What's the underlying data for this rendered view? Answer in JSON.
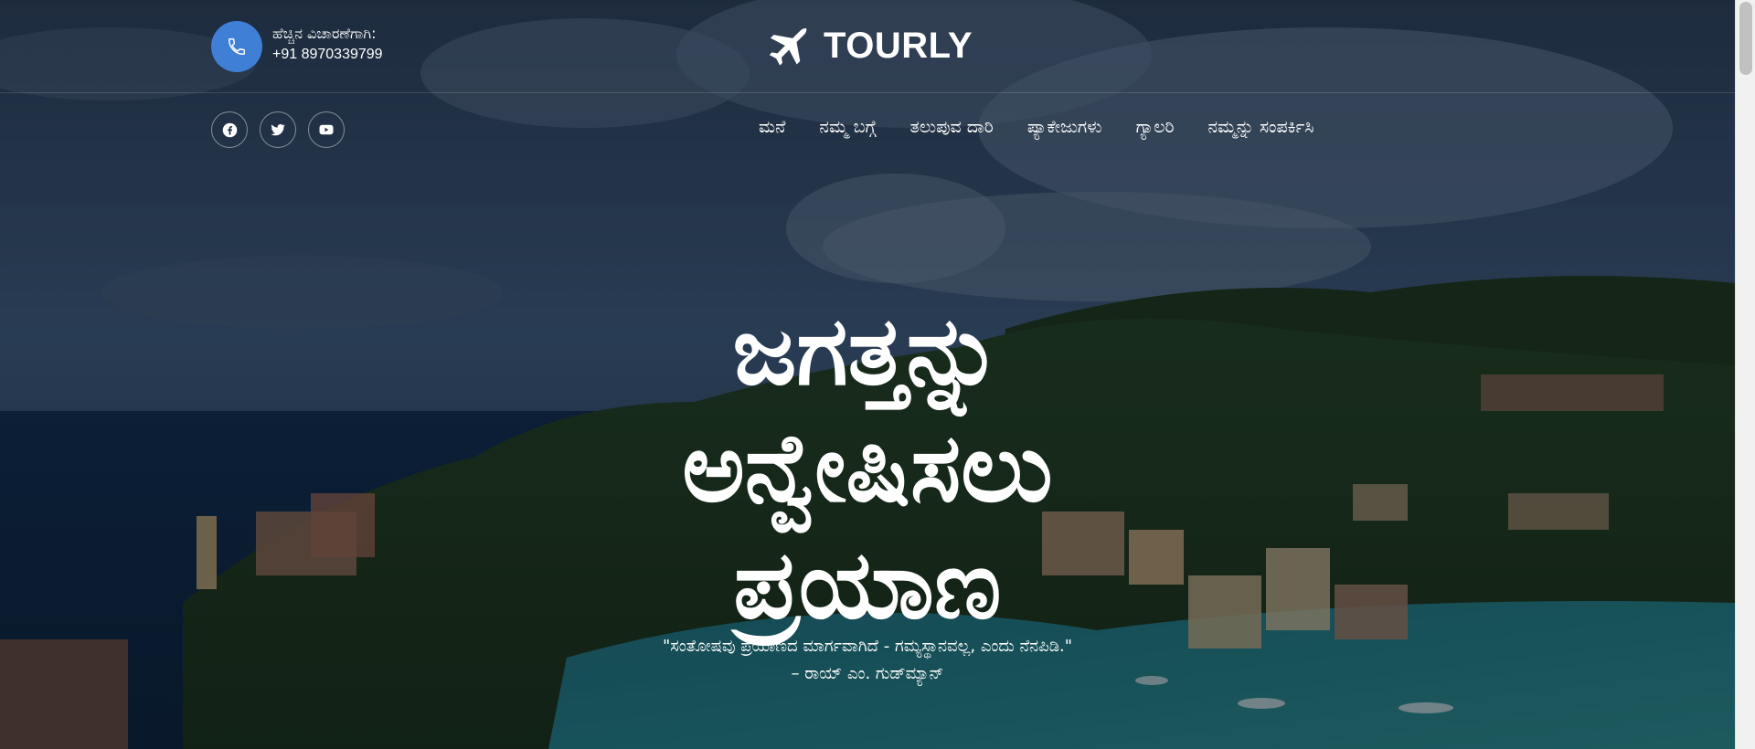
{
  "header": {
    "enquiry_label": "ಹೆಚ್ಚಿನ ವಿಚಾರಣೆಗಾಗಿ:",
    "phone": "+91 8970339799",
    "logo_text": "TOURLY"
  },
  "social": [
    {
      "icon": "facebook-icon"
    },
    {
      "icon": "twitter-icon"
    },
    {
      "icon": "youtube-icon"
    }
  ],
  "nav": {
    "items": [
      {
        "label": "ಮನೆ"
      },
      {
        "label": "ನಮ್ಮ ಬಗ್ಗೆ"
      },
      {
        "label": "ತಲುಪುವ ದಾರಿ"
      },
      {
        "label": "ಪ್ಯಾಕೇಜುಗಳು"
      },
      {
        "label": "ಗ್ಯಾಲರಿ"
      },
      {
        "label": "ನಮ್ಮನ್ನು ಸಂಪರ್ಕಿಸಿ"
      }
    ]
  },
  "hero": {
    "headline_line1": "ಜಗತ್ತನ್ನು",
    "headline_line2": "ಅನ್ವೇಷಿಸಲು",
    "headline_line3": "ಪ್ರಯಾಣ",
    "quote": "\"ಸಂತೋಷವು ಪ್ರಯಾಣದ ಮಾರ್ಗವಾಗಿದೆ - ಗಮ್ಯಸ್ಥಾನವಲ್ಲ, ಎಂದು ನೆನಪಿಡಿ.\"",
    "quote_author": "– ರಾಯ್ ಎಂ. ಗುಡ್‌ಮ್ಯಾನ್"
  },
  "colors": {
    "accent": "#3f7fd6",
    "text": "#ffffff"
  }
}
